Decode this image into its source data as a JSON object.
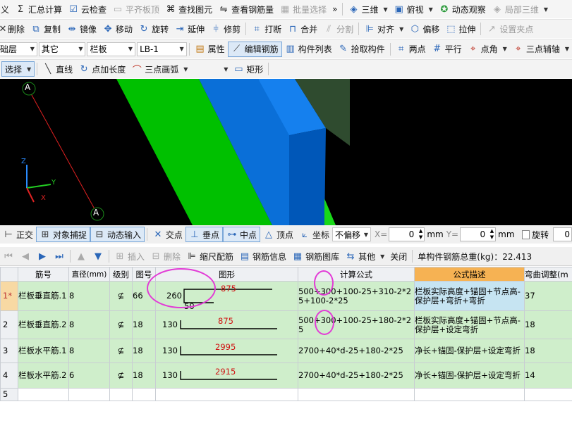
{
  "toolbar_main": {
    "items": [
      {
        "icon": "xy-icon",
        "label": "义"
      },
      {
        "icon": "sigma-icon",
        "label": "汇总计算"
      },
      {
        "icon": "cloud-check-icon",
        "label": "云检查"
      },
      {
        "icon": "flat-top-icon",
        "label": "平齐板顶"
      },
      {
        "icon": "binoculars-icon",
        "label": "查找图元"
      },
      {
        "icon": "rebar-view-icon",
        "label": "查看钢筋量"
      },
      {
        "icon": "batch-select-icon",
        "label": "批量选择"
      },
      {
        "icon": "more-icon",
        "label": "»"
      },
      {
        "icon": "cube-3d-icon",
        "label": "三维"
      },
      {
        "icon": "top-view-icon",
        "label": "俯视"
      },
      {
        "icon": "dynamic-view-icon",
        "label": "动态观察"
      },
      {
        "icon": "local-3d-icon",
        "label": "局部三维"
      }
    ]
  },
  "toolbar_edit": {
    "items": [
      {
        "icon": "delete-icon",
        "label": "删除"
      },
      {
        "icon": "copy-icon",
        "label": "复制"
      },
      {
        "icon": "mirror-icon",
        "label": "镜像"
      },
      {
        "icon": "move-icon",
        "label": "移动"
      },
      {
        "icon": "rotate-icon",
        "label": "旋转"
      },
      {
        "icon": "extend-icon",
        "label": "延伸"
      },
      {
        "icon": "trim-icon",
        "label": "修剪"
      },
      {
        "icon": "break-icon",
        "label": "打断"
      },
      {
        "icon": "merge-icon",
        "label": "合并"
      },
      {
        "icon": "split-icon",
        "label": "分割"
      },
      {
        "icon": "align-icon",
        "label": "对齐"
      },
      {
        "icon": "offset-icon",
        "label": "偏移"
      },
      {
        "icon": "stretch-icon",
        "label": "拉伸"
      },
      {
        "icon": "set-point-icon",
        "label": "设置夹点"
      }
    ]
  },
  "toolbar_props": {
    "floor": "础层",
    "category": "其它",
    "type": "栏板",
    "component": "LB-1",
    "buttons": [
      {
        "icon": "properties-icon",
        "label": "属性"
      },
      {
        "icon": "edit-rebar-icon",
        "label": "编辑钢筋"
      },
      {
        "icon": "component-list-icon",
        "label": "构件列表"
      },
      {
        "icon": "pick-component-icon",
        "label": "拾取构件"
      },
      {
        "icon": "two-point-icon",
        "label": "两点"
      },
      {
        "icon": "parallel-icon",
        "label": "平行"
      },
      {
        "icon": "point-angle-icon",
        "label": "点角"
      },
      {
        "icon": "three-point-aux-icon",
        "label": "三点辅轴"
      }
    ]
  },
  "toolbar_draw": {
    "select": "选择",
    "line": "直线",
    "point_length": "点加长度",
    "arc": "三点画弧",
    "rect": "矩形"
  },
  "viewport": {
    "axis_label_top": "A",
    "axis_label_bottom": "A",
    "gizmo_x": "X",
    "gizmo_y": "Y",
    "gizmo_z": "Z"
  },
  "toolbar_snap": {
    "orthogonal": "正交",
    "object_snap": "对象捕捉",
    "dynamic_input": "动态输入",
    "intersection": "交点",
    "perpendicular": "垂点",
    "midpoint": "中点",
    "vertex": "顶点",
    "coordinate": "坐标",
    "offset_mode": "不偏移",
    "x_label": "X=",
    "x_value": "0",
    "y_label": "Y=",
    "y_value": "0",
    "unit": "mm",
    "rotate": "旋转",
    "rotate_value": "0"
  },
  "toolbar_rebar": {
    "insert": "插入",
    "delete": "删除",
    "scale_rebar": "缩尺配筋",
    "rebar_info": "钢筋信息",
    "rebar_library": "钢筋图库",
    "other": "其他",
    "close": "关闭",
    "total_label": "单构件钢筋总重(kg)：22.413"
  },
  "table": {
    "columns": [
      "",
      "筋号",
      "直径(mm)",
      "级别",
      "图号",
      "图形",
      "计算公式",
      "公式描述",
      "弯曲调整(m"
    ],
    "rows": [
      {
        "row_no": "1*",
        "name": "栏板垂直筋.1",
        "diameter": "8",
        "grade": "⊈",
        "fig_no": "66",
        "shape": "hook",
        "dim_a": "260",
        "dim_b": "875",
        "dim_c": "50",
        "formula": "500+300+100-25+310-2*25+100-2*25",
        "description": "栏板实际高度+锚固+节点高-保护层+弯折+弯折",
        "bend_adjust": "37"
      },
      {
        "row_no": "2",
        "name": "栏板垂直筋.2",
        "diameter": "8",
        "grade": "⊈",
        "fig_no": "18",
        "shape": "L",
        "dim_a": "130",
        "dim_b": "875",
        "dim_c": "",
        "formula": "500+300+100-25+180-2*25",
        "description": "栏板实际高度+锚固+节点高-保护层+设定弯折",
        "bend_adjust": "18"
      },
      {
        "row_no": "3",
        "name": "栏板水平筋.1",
        "diameter": "8",
        "grade": "⊈",
        "fig_no": "18",
        "shape": "L",
        "dim_a": "130",
        "dim_b": "2995",
        "dim_c": "",
        "formula": "2700+40*d-25+180-2*25",
        "description": "净长+锚固-保护层+设定弯折",
        "bend_adjust": "18"
      },
      {
        "row_no": "4",
        "name": "栏板水平筋.2",
        "diameter": "6",
        "grade": "⊈",
        "fig_no": "18",
        "shape": "L",
        "dim_a": "130",
        "dim_b": "2915",
        "dim_c": "",
        "formula": "2700+40*d-25+180-2*25",
        "description": "净长+锚固-保护层+设定弯折",
        "bend_adjust": "14"
      },
      {
        "row_no": "5",
        "name": "",
        "diameter": "",
        "grade": "",
        "fig_no": "",
        "shape": "",
        "dim_a": "",
        "dim_b": "",
        "dim_c": "",
        "formula": "",
        "description": "",
        "bend_adjust": ""
      }
    ]
  },
  "colors": {
    "row_fill": "#cfeecb",
    "header_highlight": "#f6b253",
    "annotation_ring": "#e23bd6",
    "dimension_text": "#d01010"
  }
}
